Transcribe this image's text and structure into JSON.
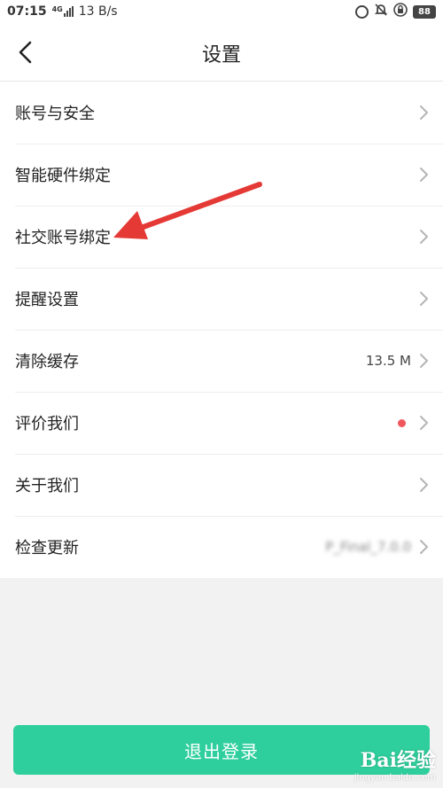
{
  "status_bar": {
    "time": "07:15",
    "network_type": "4G",
    "speed": "13 B/s",
    "battery": "88",
    "icons": [
      "eye-comfort-icon",
      "mute-bell-icon",
      "screen-lock-icon"
    ]
  },
  "header": {
    "title": "设置",
    "back_icon": "chevron-left-icon"
  },
  "settings": {
    "items": [
      {
        "label": "账号与安全"
      },
      {
        "label": "智能硬件绑定"
      },
      {
        "label": "社交账号绑定"
      },
      {
        "label": "提醒设置"
      },
      {
        "label": "清除缓存",
        "value": "13.5 M"
      },
      {
        "label": "评价我们",
        "badge": "red-dot"
      },
      {
        "label": "关于我们"
      },
      {
        "label": "检查更新",
        "value": "P_Final_7.0.0"
      }
    ]
  },
  "footer": {
    "logout_label": "退出登录"
  },
  "watermark": {
    "brand": "Bai经验",
    "url": "jingyan.baidu.com"
  },
  "colors": {
    "accent": "#2ecf9c",
    "annotation_arrow": "#e53935",
    "badge": "#f0575c",
    "background": "#f2f2f2"
  }
}
